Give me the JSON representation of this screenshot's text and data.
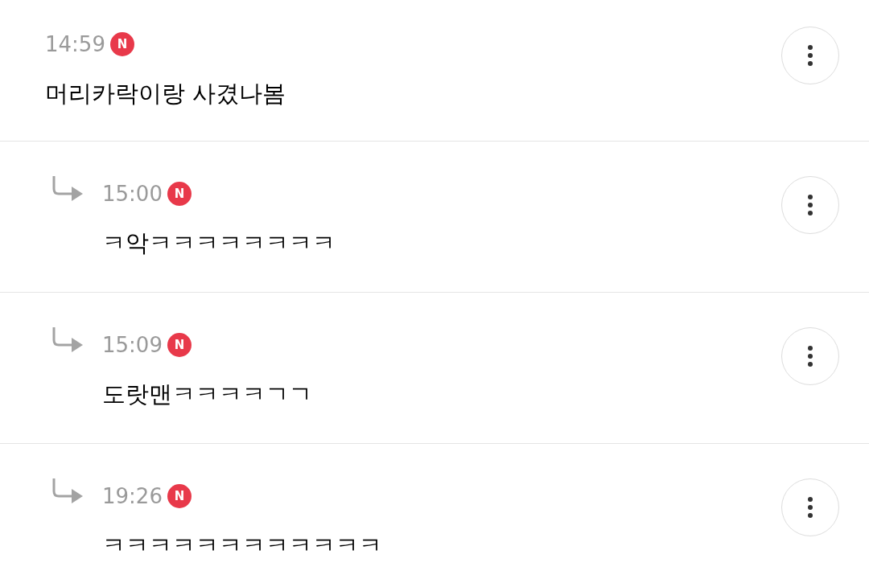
{
  "comments": [
    {
      "kind": "comment",
      "time": "14:59",
      "new_badge": "N",
      "text": "머리카락이랑 사겼나봄"
    },
    {
      "kind": "reply",
      "time": "15:00",
      "new_badge": "N",
      "text": "ㅋ악ㅋㅋㅋㅋㅋㅋㅋㅋ"
    },
    {
      "kind": "reply",
      "time": "15:09",
      "new_badge": "N",
      "text": "도랏맨ㅋㅋㅋㅋㄱㄱ"
    },
    {
      "kind": "reply",
      "time": "19:26",
      "new_badge": "N",
      "text": "ㅋㅋㅋㅋㅋㅋㅋㅋㅋㅋㅋㅋ"
    }
  ]
}
